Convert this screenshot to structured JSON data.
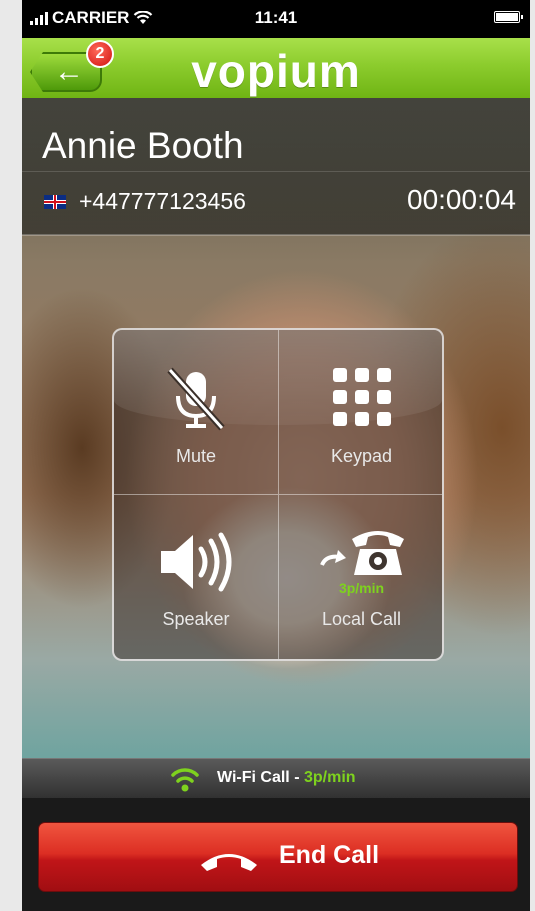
{
  "status_bar": {
    "carrier": "CARRIER",
    "time": "11:41"
  },
  "header": {
    "logo": "vopium",
    "badge_count": "2"
  },
  "caller": {
    "name": "Annie Booth",
    "number": "+447777123456",
    "duration": "00:00:04"
  },
  "controls": {
    "mute_label": "Mute",
    "keypad_label": "Keypad",
    "speaker_label": "Speaker",
    "local_call_label": "Local Call",
    "local_call_rate": "3p/min"
  },
  "connection": {
    "type": "Wi-Fi Call - ",
    "rate": "3p/min"
  },
  "end_call": {
    "label": "End Call"
  },
  "colors": {
    "accent_green": "#7ed21e",
    "end_red": "#c01518",
    "header_green": "#8ccc2d"
  }
}
